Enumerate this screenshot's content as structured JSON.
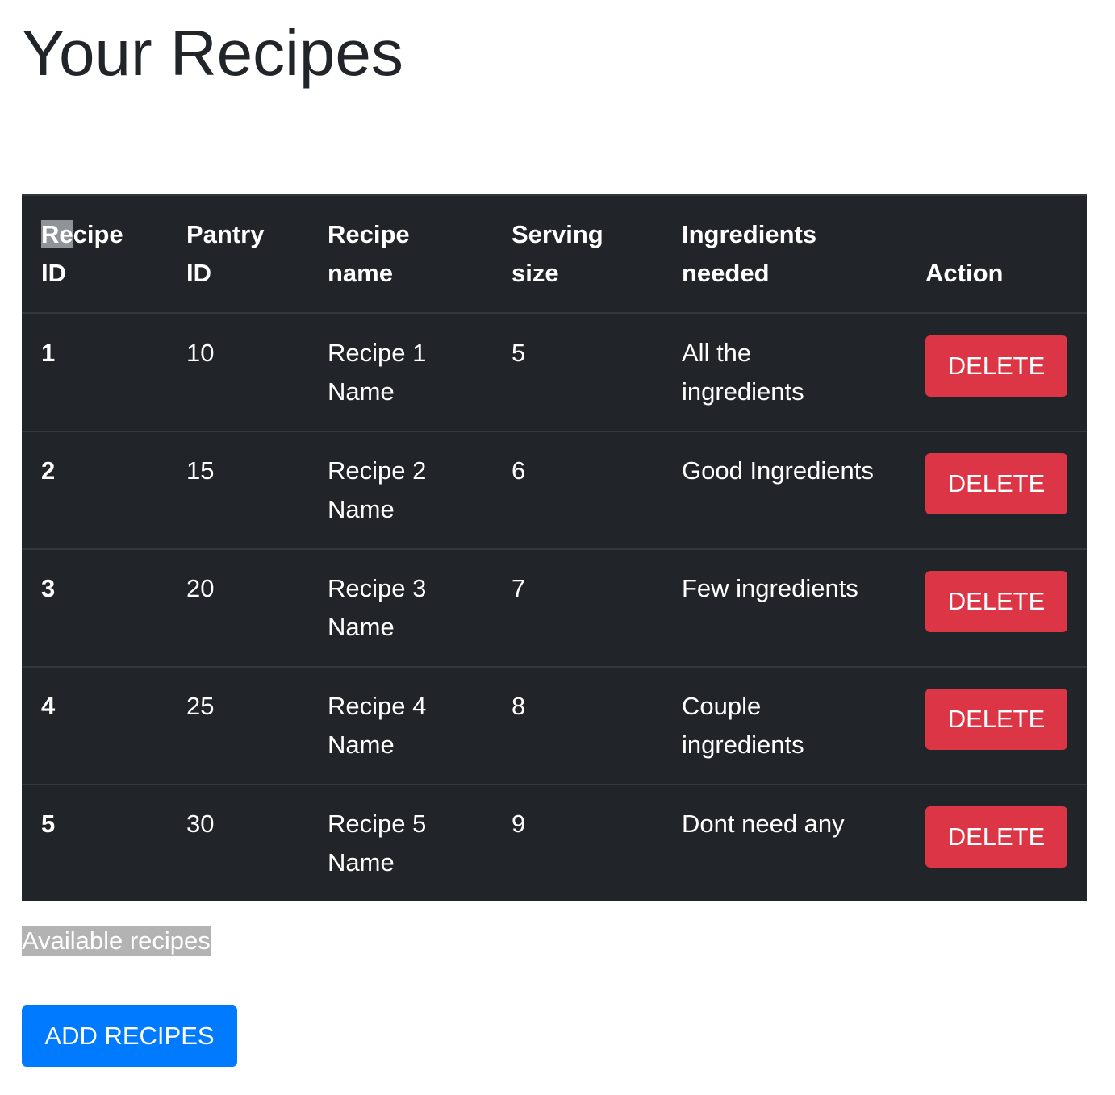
{
  "page": {
    "title": "Your Recipes"
  },
  "table": {
    "headers": {
      "recipe_id_a": "Re",
      "recipe_id_b": "cipe",
      "recipe_id_c": "ID",
      "pantry_id_a": "Pantry",
      "pantry_id_b": "ID",
      "recipe_name_a": "Recipe",
      "recipe_name_b": "name",
      "serving_size_a": "Serving",
      "serving_size_b": "size",
      "ingredients_a": "Ingredients",
      "ingredients_b": "needed",
      "action": "Action"
    },
    "rows": [
      {
        "recipe_id": "1",
        "pantry_id": "10",
        "name_a": "Recipe 1",
        "name_b": "Name",
        "serving_size": "5",
        "ingredients_a": "All the",
        "ingredients_b": "ingredients",
        "action_label": "DELETE"
      },
      {
        "recipe_id": "2",
        "pantry_id": "15",
        "name_a": "Recipe 2",
        "name_b": "Name",
        "serving_size": "6",
        "ingredients_a": "Good Ingredients",
        "ingredients_b": "",
        "action_label": "DELETE"
      },
      {
        "recipe_id": "3",
        "pantry_id": "20",
        "name_a": "Recipe 3",
        "name_b": "Name",
        "serving_size": "7",
        "ingredients_a": "Few ingredients",
        "ingredients_b": "",
        "action_label": "DELETE"
      },
      {
        "recipe_id": "4",
        "pantry_id": "25",
        "name_a": "Recipe 4",
        "name_b": "Name",
        "serving_size": "8",
        "ingredients_a": "Couple",
        "ingredients_b": "ingredients",
        "action_label": "DELETE"
      },
      {
        "recipe_id": "5",
        "pantry_id": "30",
        "name_a": "Recipe 5",
        "name_b": "Name",
        "serving_size": "9",
        "ingredients_a": "Dont need any",
        "ingredients_b": "",
        "action_label": "DELETE"
      }
    ],
    "caption": "Available recipes"
  },
  "actions": {
    "add_label": "ADD RECIPES"
  },
  "colors": {
    "table_bg": "#212529",
    "delete": "#dc3545",
    "primary": "#007bff"
  }
}
